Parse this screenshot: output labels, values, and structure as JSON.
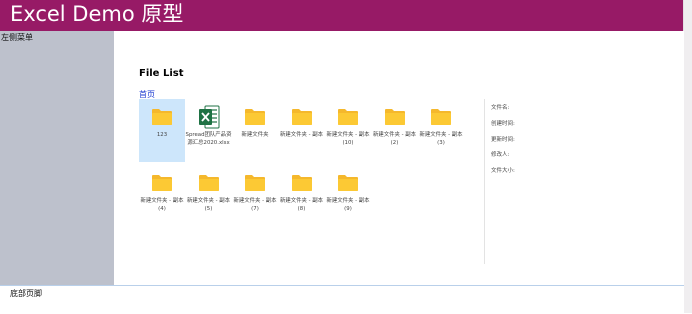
{
  "header": {
    "title": "Excel Demo 原型",
    "background": "#971a66"
  },
  "sidebar": {
    "title": "左侧菜单",
    "background": "#bdc1cc"
  },
  "main": {
    "title": "File List",
    "breadcrumb": "首页",
    "files": [
      {
        "name": "123",
        "type": "folder",
        "selected": true
      },
      {
        "name": "Spread团队产品资源汇总2020.xlsx",
        "type": "excel"
      },
      {
        "name": "新建文件夹",
        "type": "folder"
      },
      {
        "name": "新建文件夹 - 副本",
        "type": "folder"
      },
      {
        "name": "新建文件夹 - 副本 (10)",
        "type": "folder"
      },
      {
        "name": "新建文件夹 - 副本 (2)",
        "type": "folder"
      },
      {
        "name": "新建文件夹 - 副本 (3)",
        "type": "folder"
      },
      {
        "name": "新建文件夹 - 副本 (4)",
        "type": "folder"
      },
      {
        "name": "新建文件夹 - 副本 (5)",
        "type": "folder"
      },
      {
        "name": "新建文件夹 - 副本 (7)",
        "type": "folder"
      },
      {
        "name": "新建文件夹 - 副本 (8)",
        "type": "folder"
      },
      {
        "name": "新建文件夹 - 副本 (9)",
        "type": "folder"
      }
    ],
    "details": {
      "name_label": "文件名:",
      "created_label": "创建时间:",
      "modified_label": "更新时间:",
      "modifier_label": "修改人:",
      "size_label": "文件大小:"
    }
  },
  "footer": {
    "text": "底部页脚"
  },
  "colors": {
    "folder": "#fcc934",
    "folder_dark": "#f5b82c",
    "excel": "#1f7244",
    "selected": "#cde6fb",
    "link": "#1a3ad0"
  }
}
